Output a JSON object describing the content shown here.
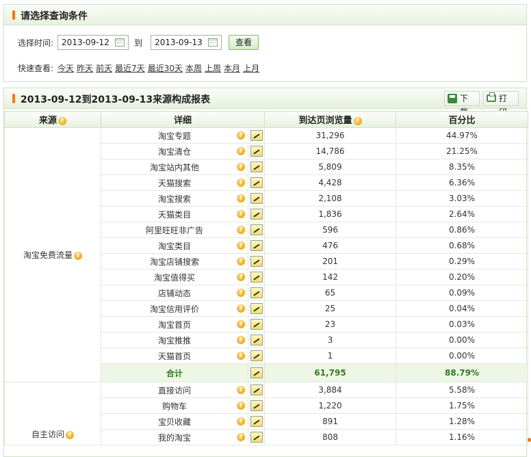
{
  "query_panel": {
    "title": "请选择查询条件",
    "time_label": "选择时间:",
    "start_date": "2013-09-12",
    "to_label": "到",
    "end_date": "2013-09-13",
    "view_button": "查看",
    "quick_label": "快速查看:",
    "quick_links": [
      "今天",
      "昨天",
      "前天",
      "最近7天",
      "最近30天",
      "本周",
      "上周",
      "本月",
      "上月"
    ]
  },
  "report_panel": {
    "title": "2013-09-12到2013-09-13来源构成报表",
    "download_label": "下载",
    "print_label": "打印",
    "columns": [
      "来源",
      "详细",
      "到达页浏览量",
      "百分比"
    ],
    "groups": [
      {
        "source": "淘宝免费流量",
        "rows": [
          {
            "detail": "淘宝专题",
            "views": "31,296",
            "percent": "44.97%"
          },
          {
            "detail": "淘宝清仓",
            "views": "14,786",
            "percent": "21.25%"
          },
          {
            "detail": "淘宝站内其他",
            "views": "5,809",
            "percent": "8.35%"
          },
          {
            "detail": "天猫搜索",
            "views": "4,428",
            "percent": "6.36%"
          },
          {
            "detail": "淘宝搜索",
            "views": "2,108",
            "percent": "3.03%"
          },
          {
            "detail": "天猫类目",
            "views": "1,836",
            "percent": "2.64%"
          },
          {
            "detail": "阿里旺旺非广告",
            "views": "596",
            "percent": "0.86%"
          },
          {
            "detail": "淘宝类目",
            "views": "476",
            "percent": "0.68%"
          },
          {
            "detail": "淘宝店铺搜索",
            "views": "201",
            "percent": "0.29%"
          },
          {
            "detail": "淘宝值得买",
            "views": "142",
            "percent": "0.20%"
          },
          {
            "detail": "店铺动态",
            "views": "65",
            "percent": "0.09%"
          },
          {
            "detail": "淘宝信用评价",
            "views": "25",
            "percent": "0.04%"
          },
          {
            "detail": "淘宝首页",
            "views": "23",
            "percent": "0.03%"
          },
          {
            "detail": "淘宝推推",
            "views": "3",
            "percent": "0.00%"
          },
          {
            "detail": "天猫首页",
            "views": "1",
            "percent": "0.00%"
          }
        ],
        "total": {
          "label": "合计",
          "views": "61,795",
          "percent": "88.79%"
        }
      },
      {
        "source": "自主访问",
        "rows": [
          {
            "detail": "直接访问",
            "views": "3,884",
            "percent": "5.58%"
          },
          {
            "detail": "购物车",
            "views": "1,220",
            "percent": "1.75%"
          },
          {
            "detail": "宝贝收藏",
            "views": "891",
            "percent": "1.28%"
          },
          {
            "detail": "我的淘宝",
            "views": "808",
            "percent": "1.16%"
          }
        ]
      }
    ]
  }
}
